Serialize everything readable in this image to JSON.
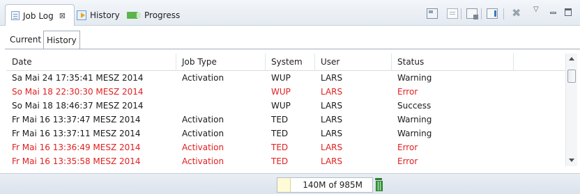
{
  "view_tabs": [
    {
      "label": "Job Log",
      "icon": "job-log-icon",
      "active": true,
      "close": "⊠"
    },
    {
      "label": "History",
      "icon": "history-icon",
      "active": false
    },
    {
      "label": "Progress",
      "icon": "progress-icon",
      "active": false
    }
  ],
  "toolbar": [
    "refresh-icon",
    "document-icon",
    "export-icon",
    "filter-icon",
    "delete-icon",
    "view-menu-icon",
    "minimize-icon",
    "maximize-icon"
  ],
  "inner_tabs": [
    {
      "label": "Current",
      "active": false
    },
    {
      "label": "History",
      "active": true
    }
  ],
  "table": {
    "columns": [
      "Date",
      "Job Type",
      "System",
      "User",
      "Status",
      ""
    ],
    "rows": [
      {
        "date": "Sa Mai 24 17:35:41 MESZ 2014",
        "job_type": "Activation",
        "system": "WUP",
        "user": "LARS",
        "status": "Warning",
        "error": false
      },
      {
        "date": "So Mai 18 22:30:30 MESZ 2014",
        "job_type": "",
        "system": "WUP",
        "user": "LARS",
        "status": "Error",
        "error": true
      },
      {
        "date": "So Mai 18 18:46:37 MESZ 2014",
        "job_type": "",
        "system": "WUP",
        "user": "LARS",
        "status": "Success",
        "error": false
      },
      {
        "date": "Fr Mai 16 13:37:47 MESZ 2014",
        "job_type": "Activation",
        "system": "TED",
        "user": "LARS",
        "status": "Warning",
        "error": false
      },
      {
        "date": "Fr Mai 16 13:37:11 MESZ 2014",
        "job_type": "Activation",
        "system": "TED",
        "user": "LARS",
        "status": "Warning",
        "error": false
      },
      {
        "date": "Fr Mai 16 13:36:49 MESZ 2014",
        "job_type": "Activation",
        "system": "TED",
        "user": "LARS",
        "status": "Error",
        "error": true
      },
      {
        "date": "Fr Mai 16 13:35:58 MESZ 2014",
        "job_type": "Activation",
        "system": "TED",
        "user": "LARS",
        "status": "Error",
        "error": true
      }
    ]
  },
  "colors": {
    "error_text": "#e02020",
    "normal_text": "#1a1a1a"
  },
  "status_bar": {
    "heap": "140M of 985M",
    "heap_used_fraction": 0.142,
    "gc_icon": "garbage-collect-icon"
  }
}
